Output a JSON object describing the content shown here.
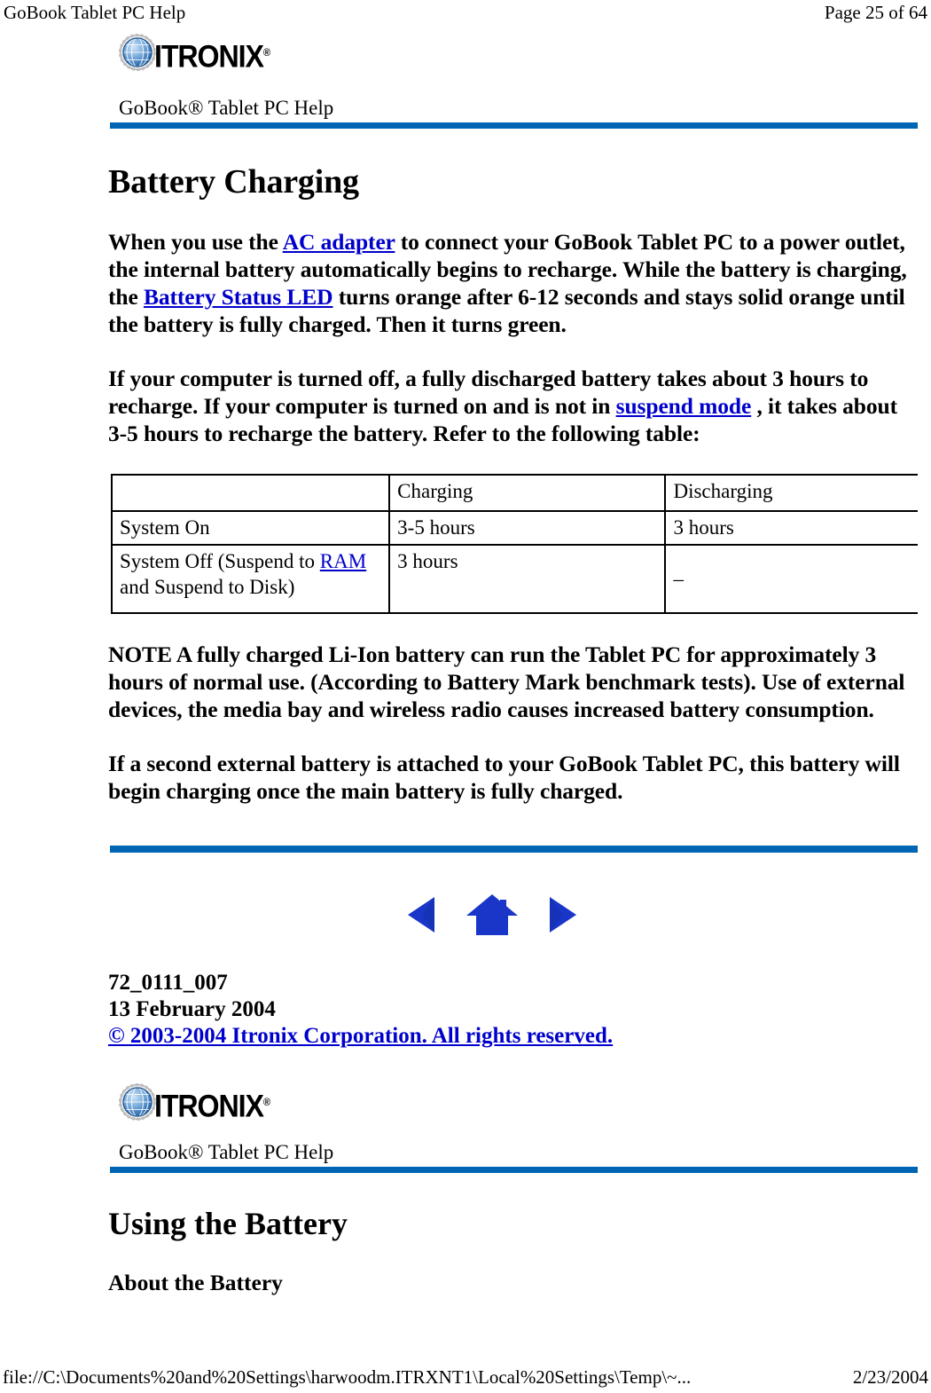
{
  "print_header": {
    "left_title": "GoBook Tablet PC Help",
    "page_indicator": "Page 25 of 64"
  },
  "brand": {
    "logo_text": "ITRONIX",
    "logo_registered_mark": "®",
    "globe_icon_name": "itronix-globe-icon",
    "globe_color_light": "#8ab4e0",
    "globe_color_dark": "#1b5fa8",
    "globe_ring_color": "#c8c8c8"
  },
  "masthead": {
    "title": "GoBook® Tablet PC Help",
    "rule_color": "#0066b3"
  },
  "section_one": {
    "heading": "Battery Charging",
    "paragraph_1": {
      "part_a": "When you use the ",
      "link_1": "AC adapter",
      "part_b": " to connect your GoBook Tablet PC to a power outlet, the internal battery automatically begins to recharge. While the battery is charging, the ",
      "link_2": "Battery Status LED",
      "part_c": " turns orange after 6-12 seconds and stays solid orange until the battery is fully charged. Then it turns green."
    },
    "paragraph_2": {
      "part_a": "If your computer is turned off, a fully discharged battery takes about 3 hours to recharge. If your computer is turned on and is not in ",
      "link_1": "suspend mode",
      "part_b": " , it takes about 3-5 hours to recharge the battery. Refer to the following table:"
    },
    "note_paragraph": "NOTE  A fully charged Li-Ion battery can run the Tablet PC for approximately 3 hours of normal use. (According to Battery Mark benchmark tests).  Use of external devices, the media bay and wireless radio causes increased battery consumption.",
    "closing_paragraph": "If a second external battery is attached to your GoBook Tablet PC, this battery will begin charging once the main battery is fully charged."
  },
  "battery_table": {
    "header": {
      "corner": "",
      "charging": "Charging",
      "discharging": "Discharging"
    },
    "rows": [
      {
        "label": "System On",
        "label_link": "",
        "label_suffix": "",
        "charging": "3-5 hours",
        "discharging": "3 hours"
      },
      {
        "label_prefix": "System Off (Suspend to ",
        "label_link": "RAM",
        "label_suffix": " and Suspend to Disk)",
        "charging": "3 hours",
        "discharging": "–"
      }
    ]
  },
  "nav": {
    "back_label": "back-arrow",
    "home_label": "home",
    "forward_label": "forward-arrow",
    "icon_color": "#1a36c8"
  },
  "doc_meta": {
    "doc_number": "72_0111_007",
    "date": "13 February 2004",
    "copyright": "© 2003-2004 Itronix Corporation.  All rights reserved."
  },
  "section_two": {
    "heading": "Using the Battery",
    "subheading": "About the Battery"
  },
  "status_bar": {
    "file_path": "file://C:\\Documents%20and%20Settings\\harwoodm.ITRXNT1\\Local%20Settings\\Temp\\~...",
    "date": "2/23/2004"
  }
}
